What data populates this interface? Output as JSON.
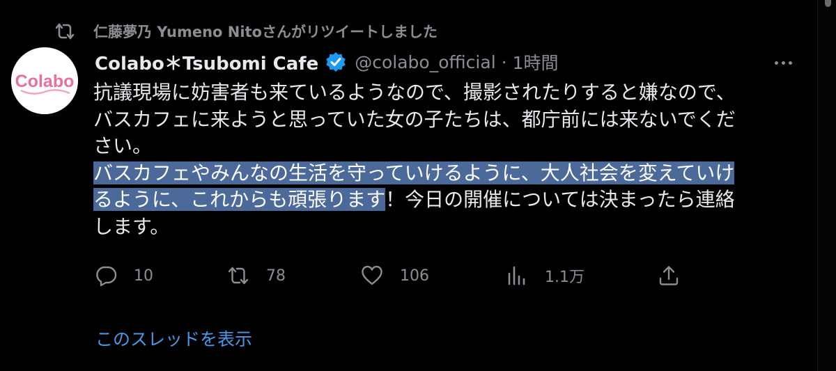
{
  "retweet": {
    "icon": "retweet-icon",
    "label": "仁藤夢乃  Yumeno Nitoさんがリツイートしました"
  },
  "tweet": {
    "avatar_text": "Colabo",
    "display_name": "Colabo＊Tsubomi Cafe",
    "verified_icon": "verified-badge-icon",
    "handle": "@colabo_official",
    "separator": "·",
    "time": "1時間",
    "text_lines": [
      {
        "plain": "抗議現場に妨害者も来ているようなので、撮影されたりすると嫌なので、",
        "highlighted": "",
        "after": ""
      },
      {
        "plain": "バスカフェに来ようと思っていた女の子たちは、都庁前には来ないでくだ",
        "highlighted": "",
        "after": ""
      },
      {
        "plain": "さい。",
        "highlighted": "",
        "after": ""
      },
      {
        "plain": "",
        "highlighted": "バスカフェやみんなの生活を守っていけるように、大人社会を変えていけ",
        "after": ""
      },
      {
        "plain": "",
        "highlighted": "るように、これからも頑張ります",
        "after": "！今日の開催については決まったら連絡"
      },
      {
        "plain": "します。",
        "highlighted": "",
        "after": ""
      }
    ]
  },
  "actions": {
    "reply": {
      "icon": "reply-icon",
      "count": "10"
    },
    "retweet": {
      "icon": "retweet-icon",
      "count": "78"
    },
    "like": {
      "icon": "heart-icon",
      "count": "106"
    },
    "views": {
      "icon": "analytics-icon",
      "count": "1.1万"
    },
    "share": {
      "icon": "share-icon"
    }
  },
  "show_thread": "このスレッドを表示",
  "colors": {
    "background": "#000000",
    "text": "#e7e9ea",
    "muted": "#8b8f94",
    "link": "#4a99e9",
    "selection": "#4b6a99",
    "verified": "#1d9bf0",
    "logo_pink": "#e8709c"
  }
}
